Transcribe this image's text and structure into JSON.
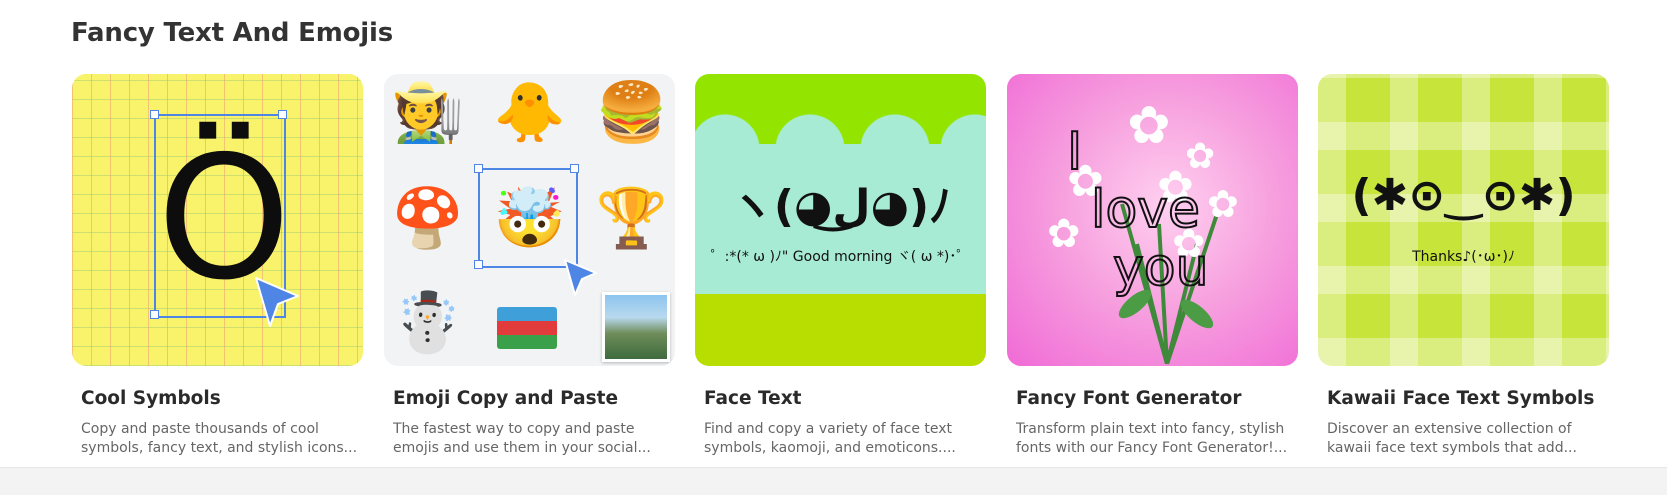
{
  "section": {
    "title": "Fancy Text And Emojis"
  },
  "cards": [
    {
      "title": "Cool Symbols",
      "description": "Copy and paste thousands of cool symbols, fancy text, and stylish icons...",
      "thumb": {
        "glyph": "Ö"
      }
    },
    {
      "title": "Emoji Copy and Paste",
      "description": "The fastest way to copy and paste emojis and use them in your social...",
      "thumb": {
        "emojis": [
          "🧑‍🌾",
          "🐥",
          "🍔",
          "🍄",
          "🤯",
          "🏆",
          "☃️"
        ]
      }
    },
    {
      "title": "Face Text",
      "description": "Find and copy a variety of face text symbols, kaomoji, and emoticons....",
      "thumb": {
        "main": "ヽ(◕ل͜◕)ﾉ",
        "sub": "゜:*(* ω )ﾉ\" Good morning ヾ( ω *)･゜"
      }
    },
    {
      "title": "Fancy Font Generator",
      "description": "Transform plain text into fancy, stylish fonts with our Fancy Font Generator!...",
      "thumb": {
        "line1": "I",
        "line2": "love",
        "line3": "you"
      }
    },
    {
      "title": "Kawaii Face Text Symbols",
      "description": "Discover an extensive collection of kawaii face text symbols that add...",
      "thumb": {
        "main": "(✱⊙‿⊙✱)",
        "sub": "Thanks♪(･ω･)ﾉ"
      }
    }
  ],
  "icons": {
    "cursor": "pointer-cursor-icon",
    "flag": "azerbaijan-flag-icon",
    "photo": "landscape-photo-icon"
  },
  "colors": {
    "selection": "#4f86e6",
    "cool_bg": "#f8f36a",
    "face_bg": "#a7ebd4",
    "font_bg": "#f06ad6",
    "kawaii_bg": "#c7e43a"
  }
}
